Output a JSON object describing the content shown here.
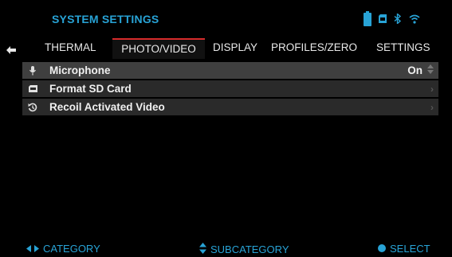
{
  "header": {
    "title": "SYSTEM SETTINGS",
    "icons": [
      "battery-icon",
      "sd-card-icon",
      "bluetooth-icon",
      "wifi-icon"
    ]
  },
  "tabs": [
    {
      "label": "THERMAL",
      "active": false
    },
    {
      "label": "PHOTO/VIDEO",
      "active": true
    },
    {
      "label": "DISPLAY",
      "active": false
    },
    {
      "label": "PROFILES/ZERO",
      "active": false
    },
    {
      "label": "SETTINGS",
      "active": false
    }
  ],
  "menu": {
    "items": [
      {
        "icon": "microphone-icon",
        "label": "Microphone",
        "value": "On",
        "control": "up-down-arrows",
        "selected": true
      },
      {
        "icon": "sd-card-icon",
        "label": "Format SD Card",
        "value": "",
        "control": "chevron-right"
      },
      {
        "icon": "recoil-icon",
        "label": "Recoil Activated Video",
        "value": "",
        "control": "chevron-right"
      }
    ]
  },
  "footer": {
    "category": "CATEGORY",
    "subcategory": "SUBCATEGORY",
    "select": "SELECT"
  },
  "colors": {
    "accent": "#28a3d6",
    "active_tab_border": "#d62b2b",
    "row_bg": "#2a2a2a",
    "row_selected_bg": "#3f3f3f",
    "background": "#000000"
  }
}
